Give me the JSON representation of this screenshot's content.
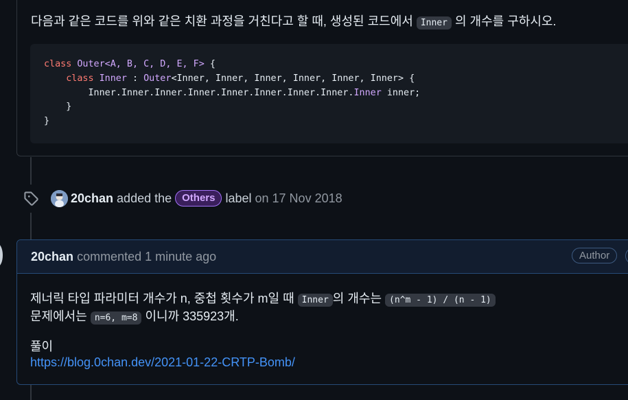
{
  "question": {
    "before": "다음과 같은 코드를 위와 같은 치환 과정을 거친다고 할 때, 생성된 코드에서 ",
    "code": "Inner",
    "after": " 의 개수를 구하시오."
  },
  "code_block": {
    "l1_kw": "class",
    "l1_type": "Outer<A, B, C, D, E, F>",
    "l1_rest": " {",
    "l2_kw": "class",
    "l2_type": "Inner",
    "l2_mid": " : ",
    "l2_type2": "Outer",
    "l2_rest": "<Inner, Inner, Inner, Inner, Inner, Inner> {",
    "l3_a": "Inner.Inner.Inner.Inner.Inner.Inner.Inner.Inner.",
    "l3_type": "Inner",
    "l3_rest": " inner;",
    "l4": "}",
    "l5": "}"
  },
  "event": {
    "author": "20chan",
    "action": "added the",
    "label": "Others",
    "label_suffix": "label",
    "date": "on 17 Nov 2018",
    "label_color": "#a371f7"
  },
  "comment": {
    "author": "20chan",
    "meta": "commented 1 minute ago",
    "badge": "Author",
    "line1_a": "제너릭 타입 파라미터 개수가 n, 중첩 횟수가 m일 때 ",
    "line1_code1": "Inner",
    "line1_b": "의 개수는 ",
    "line1_code2": "(n^m - 1) / (n - 1)",
    "line2_a": "문제에서는 ",
    "line2_code": "n=6, m=8",
    "line2_b": " 이니까 335923개.",
    "line3": "풀이",
    "link": "https://blog.0chan.dev/2021-01-22-CRTP-Bomb/"
  }
}
